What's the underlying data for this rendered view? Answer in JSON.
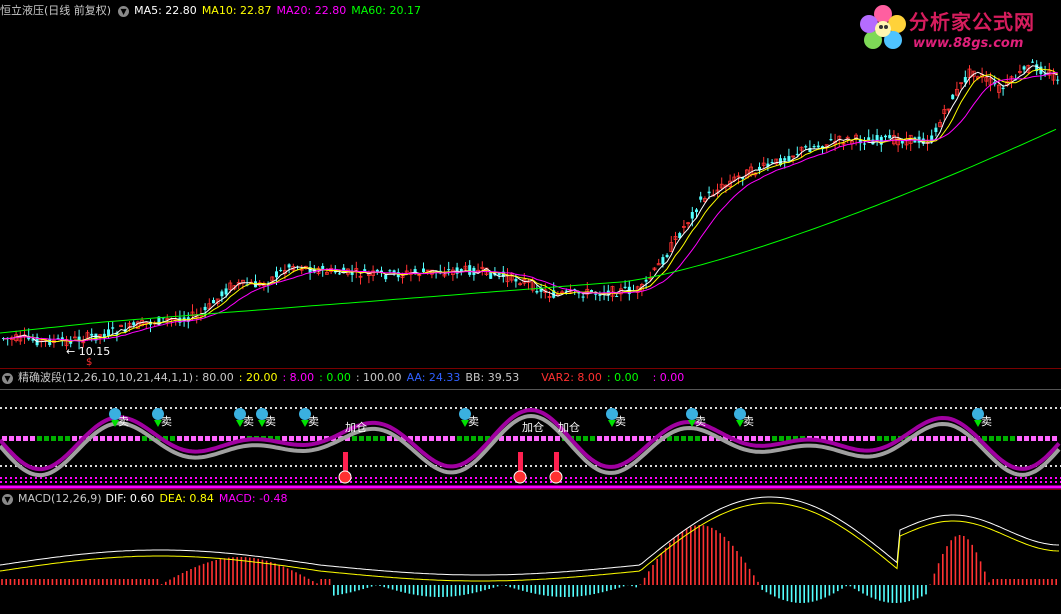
{
  "main_panel": {
    "title": "恒立液压(日线 前复权)",
    "ma": [
      {
        "label": "MA5: 22.80",
        "color": "#ffffff"
      },
      {
        "label": "MA10: 22.87",
        "color": "#ffff00"
      },
      {
        "label": "MA20: 22.80",
        "color": "#ff00ff"
      },
      {
        "label": "MA60: 20.17",
        "color": "#00ff00"
      }
    ],
    "low_marker": "10.15",
    "dollar_marker": "$"
  },
  "indicator_panel": {
    "title": "精确波段(12,26,10,10,21,44,1,1)",
    "values": [
      {
        "text": ": 80.00",
        "color": "#c8c8c8"
      },
      {
        "text": ": 20.00",
        "color": "#ffff00"
      },
      {
        "text": ": 8.00",
        "color": "#ff00ff"
      },
      {
        "text": ": 0.00",
        "color": "#00ff00"
      },
      {
        "text": ": 100.00",
        "color": "#c8c8c8"
      },
      {
        "text": "AA: 24.33",
        "color": "#3060ff"
      },
      {
        "text": "BB: 39.53",
        "color": "#c8c8c8"
      },
      {
        "text": "VAR2: 8.00",
        "color": "#ff3030"
      },
      {
        "text": ": 0.00",
        "color": "#00ff00"
      },
      {
        "text": ": 0.00",
        "color": "#ff00ff"
      }
    ],
    "sell_label": "卖",
    "add_label": "加仓"
  },
  "macd_panel": {
    "title": "MACD(12,26,9)",
    "dif": "DIF: 0.60",
    "dea": "DEA: 0.84",
    "macd": "MACD: -0.48"
  },
  "logo": {
    "title": "分析家公式网",
    "url": "www.88gs.com"
  },
  "colors": {
    "up": "#ff3232",
    "down": "#54ffff",
    "ma5": "#ffffff",
    "ma10": "#ffff00",
    "ma20": "#ff00ff",
    "ma60": "#00ff00"
  }
}
